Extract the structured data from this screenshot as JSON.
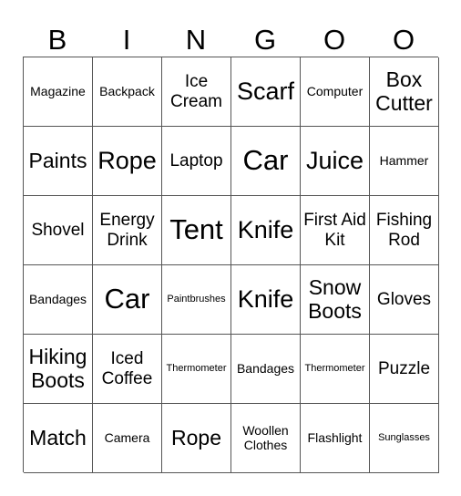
{
  "header": {
    "letters": [
      "B",
      "I",
      "N",
      "G",
      "O",
      "O"
    ]
  },
  "grid": {
    "rows": [
      [
        {
          "text": "Magazine",
          "size": "s-sm"
        },
        {
          "text": "Backpack",
          "size": "s-sm"
        },
        {
          "text": "Ice Cream",
          "size": "s-md"
        },
        {
          "text": "Scarf",
          "size": "s-xl"
        },
        {
          "text": "Computer",
          "size": "s-sm"
        },
        {
          "text": "Box Cutter",
          "size": "s-lg"
        }
      ],
      [
        {
          "text": "Paints",
          "size": "s-lg"
        },
        {
          "text": "Rope",
          "size": "s-xl"
        },
        {
          "text": "Laptop",
          "size": "s-md"
        },
        {
          "text": "Car",
          "size": "s-xxl"
        },
        {
          "text": "Juice",
          "size": "s-xl"
        },
        {
          "text": "Hammer",
          "size": "s-sm"
        }
      ],
      [
        {
          "text": "Shovel",
          "size": "s-md"
        },
        {
          "text": "Energy Drink",
          "size": "s-md"
        },
        {
          "text": "Tent",
          "size": "s-xxl"
        },
        {
          "text": "Knife",
          "size": "s-xl"
        },
        {
          "text": "First Aid Kit",
          "size": "s-md"
        },
        {
          "text": "Fishing Rod",
          "size": "s-md"
        }
      ],
      [
        {
          "text": "Bandages",
          "size": "s-sm"
        },
        {
          "text": "Car",
          "size": "s-xxl"
        },
        {
          "text": "Paintbrushes",
          "size": "s-xs"
        },
        {
          "text": "Knife",
          "size": "s-xl"
        },
        {
          "text": "Snow Boots",
          "size": "s-lg"
        },
        {
          "text": "Gloves",
          "size": "s-md"
        }
      ],
      [
        {
          "text": "Hiking Boots",
          "size": "s-lg"
        },
        {
          "text": "Iced Coffee",
          "size": "s-md"
        },
        {
          "text": "Thermometer",
          "size": "s-xs"
        },
        {
          "text": "Bandages",
          "size": "s-sm"
        },
        {
          "text": "Thermometer",
          "size": "s-xs"
        },
        {
          "text": "Puzzle",
          "size": "s-md"
        }
      ],
      [
        {
          "text": "Match",
          "size": "s-lg"
        },
        {
          "text": "Camera",
          "size": "s-sm"
        },
        {
          "text": "Rope",
          "size": "s-lg"
        },
        {
          "text": "Woollen Clothes",
          "size": "s-sm"
        },
        {
          "text": "Flashlight",
          "size": "s-sm"
        },
        {
          "text": "Sunglasses",
          "size": "s-xs"
        }
      ]
    ]
  }
}
